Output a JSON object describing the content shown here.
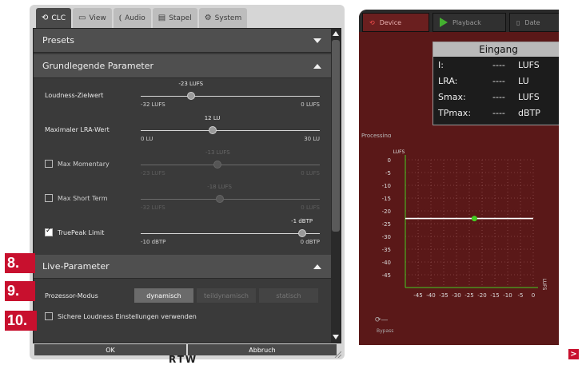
{
  "dialog": {
    "tabs": [
      {
        "label": "CLC",
        "icon": "clc-icon"
      },
      {
        "label": "View",
        "icon": "monitor-icon"
      },
      {
        "label": "Audio",
        "icon": "audio-icon"
      },
      {
        "label": "Stapel",
        "icon": "stack-icon"
      },
      {
        "label": "System",
        "icon": "gear-icon"
      }
    ],
    "presets_label": "Presets",
    "basic_section": "Grundlegende Parameter",
    "params": [
      {
        "label": "Loudness-Zielwert",
        "value": "-23 LUFS",
        "min": "-32 LUFS",
        "max": "0 LUFS",
        "fraction": 0.28,
        "enabled": true,
        "checkbox": false
      },
      {
        "label": "Maximaler LRA-Wert",
        "value": "12 LU",
        "min": "0 LU",
        "max": "30 LU",
        "fraction": 0.4,
        "enabled": true,
        "checkbox": false
      },
      {
        "label": "Max Momentary",
        "value": "-13 LUFS",
        "min": "-23 LUFS",
        "max": "0 LUFS",
        "fraction": 0.43,
        "enabled": false,
        "checkbox": true,
        "checked": false
      },
      {
        "label": "Max Short Term",
        "value": "-18 LUFS",
        "min": "-32 LUFS",
        "max": "0 LUFS",
        "fraction": 0.44,
        "enabled": false,
        "checkbox": true,
        "checked": false
      },
      {
        "label": "TruePeak Limit",
        "value": "-1 dBTP",
        "min": "-10 dBTP",
        "max": "0 dBTP",
        "fraction": 0.9,
        "enabled": true,
        "checkbox": true,
        "checked": true
      }
    ],
    "live_section": "Live-Parameter",
    "mode_label": "Prozessor-Modus",
    "modes": [
      "dynamisch",
      "teildynamisch",
      "statisch"
    ],
    "selected_mode": "dynamisch",
    "safe_label": "Sichere Loudness Einstellungen verwenden",
    "ok_label": "OK",
    "cancel_label": "Abbruch",
    "logo": "RTW"
  },
  "badges": {
    "b8": "8.",
    "b9": "9.",
    "b10": "10."
  },
  "device": {
    "tabs": {
      "device": "Device",
      "playback": "Playback",
      "date": "Date"
    },
    "eingang_title": "Eingang",
    "rows": [
      {
        "key": "I:",
        "value": "----",
        "unit": "LUFS"
      },
      {
        "key": "LRA:",
        "value": "----",
        "unit": "LU"
      },
      {
        "key": "Smax:",
        "value": "----",
        "unit": "LUFS"
      },
      {
        "key": "TPmax:",
        "value": "----",
        "unit": "dBTP"
      }
    ],
    "processing_label": "Processing",
    "bypass_label": "Bypass"
  },
  "chart_data": {
    "type": "line",
    "ylabel": "LUFS",
    "xlabel": "LUFS",
    "y_ticks": [
      0,
      -5,
      -10,
      -15,
      -20,
      -25,
      -30,
      -35,
      -40,
      -45
    ],
    "x_ticks": [
      -45,
      -40,
      -35,
      -30,
      -25,
      -20,
      -15,
      -10,
      -5,
      0
    ],
    "xlim": [
      -50,
      0
    ],
    "ylim": [
      -50,
      0
    ],
    "series": [
      {
        "x": [
          -50,
          0
        ],
        "y": [
          -23,
          -23
        ]
      }
    ],
    "marker": {
      "x": -23,
      "y": -23
    },
    "grid": true
  },
  "colors": {
    "accent": "#c8102e",
    "device_bg": "#5a1818",
    "marker": "#44cc22"
  }
}
